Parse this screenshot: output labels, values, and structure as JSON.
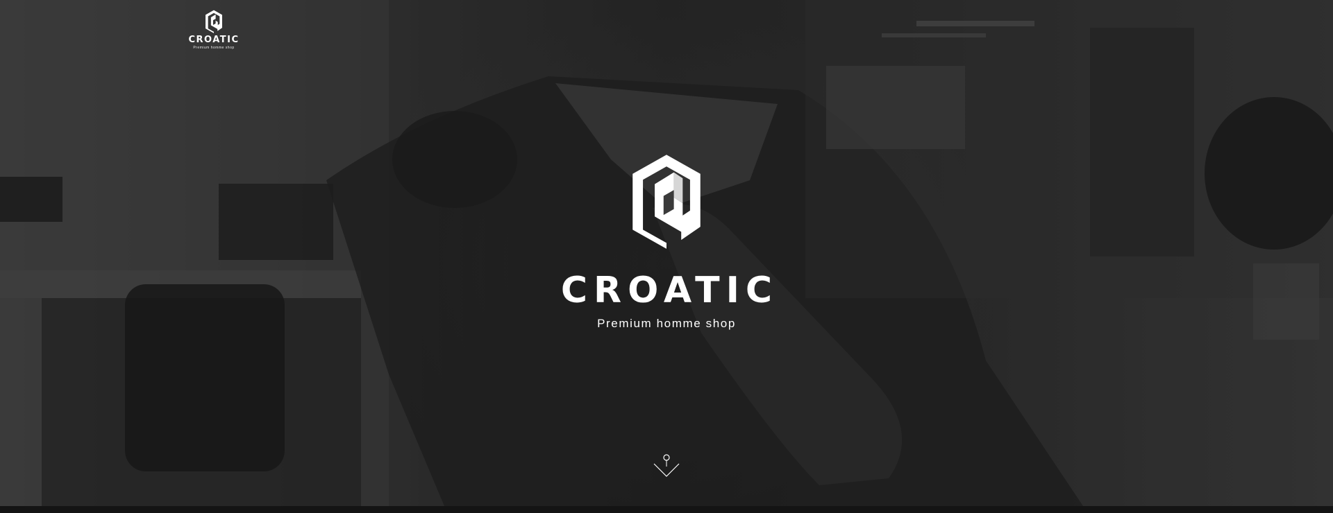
{
  "header": {
    "logo": {
      "brand": "CROATIC",
      "tagline": "Premium homme shop",
      "icon": "croatic-logo-icon"
    }
  },
  "hero": {
    "brand": "CROATIC",
    "tagline": "Premium homme shop",
    "icon": "croatic-logo-icon",
    "scroll_icon": "scroll-down-icon"
  },
  "colors": {
    "text": "#ffffff",
    "bottom_bar": "#141414",
    "background": "#2f2f2f"
  }
}
